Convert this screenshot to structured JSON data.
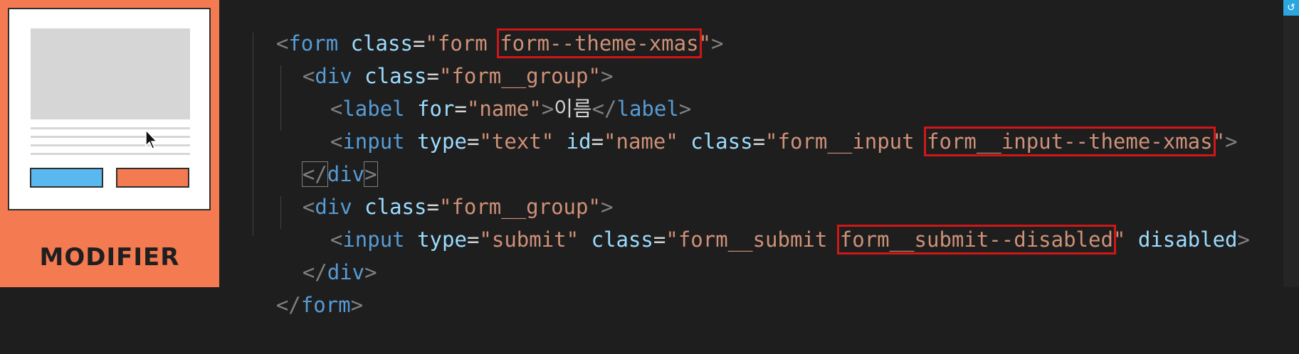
{
  "card": {
    "title": "MODIFIER",
    "colors": {
      "background": "#f47a52",
      "primary_button": "#59b8ef",
      "modifier_button": "#f47a52"
    }
  },
  "code": {
    "line1": {
      "open": "<",
      "tag": "form",
      "attr": "class",
      "eq": "=",
      "q": "\"",
      "val": "form ",
      "val_hl": "form--theme-xmas",
      "close": ">"
    },
    "line2": {
      "open": "<",
      "tag": "div",
      "attr": "class",
      "eq": "=",
      "val": "\"form__group\"",
      "close": ">"
    },
    "line3": {
      "open": "<",
      "tag": "label",
      "attr": "for",
      "eq": "=",
      "val": "\"name\"",
      "close": ">",
      "text": "이름",
      "end_open": "</",
      "end_tag": "label",
      "end_close": ">"
    },
    "line4": {
      "open": "<",
      "tag": "input",
      "attr1": "type",
      "eq": "=",
      "val1": "\"text\"",
      "attr2": "id",
      "val2": "\"name\"",
      "attr3": "class",
      "q": "\"",
      "val3": "form__input ",
      "val3_hl": "form__input--theme-xmas",
      "close": ">"
    },
    "line5": {
      "end_open": "</",
      "tag": "div",
      "close": ">"
    },
    "line6": {
      "open": "<",
      "tag": "div",
      "attr": "class",
      "eq": "=",
      "val": "\"form__group\"",
      "close": ">"
    },
    "line7": {
      "open": "<",
      "tag": "input",
      "attr1": "type",
      "eq": "=",
      "val1": "\"submit\"",
      "attr2": "class",
      "q": "\"",
      "val2": "form__submit ",
      "val2_hl": "form__submit--disabled",
      "attr3": "disabled",
      "close": ">"
    },
    "line8": {
      "end_open": "</",
      "tag": "div",
      "close": ">"
    },
    "line9": {
      "end_open": "</",
      "tag": "form",
      "close": ">"
    }
  },
  "colors": {
    "editor_bg": "#1e1e1e",
    "highlight_box": "#d01717",
    "tag": "#569cd6",
    "attribute": "#9cdcfe",
    "string": "#ce9178"
  },
  "icons": {
    "cursor": "mouse-pointer-icon",
    "scroll": "scroll-indicator-icon"
  }
}
